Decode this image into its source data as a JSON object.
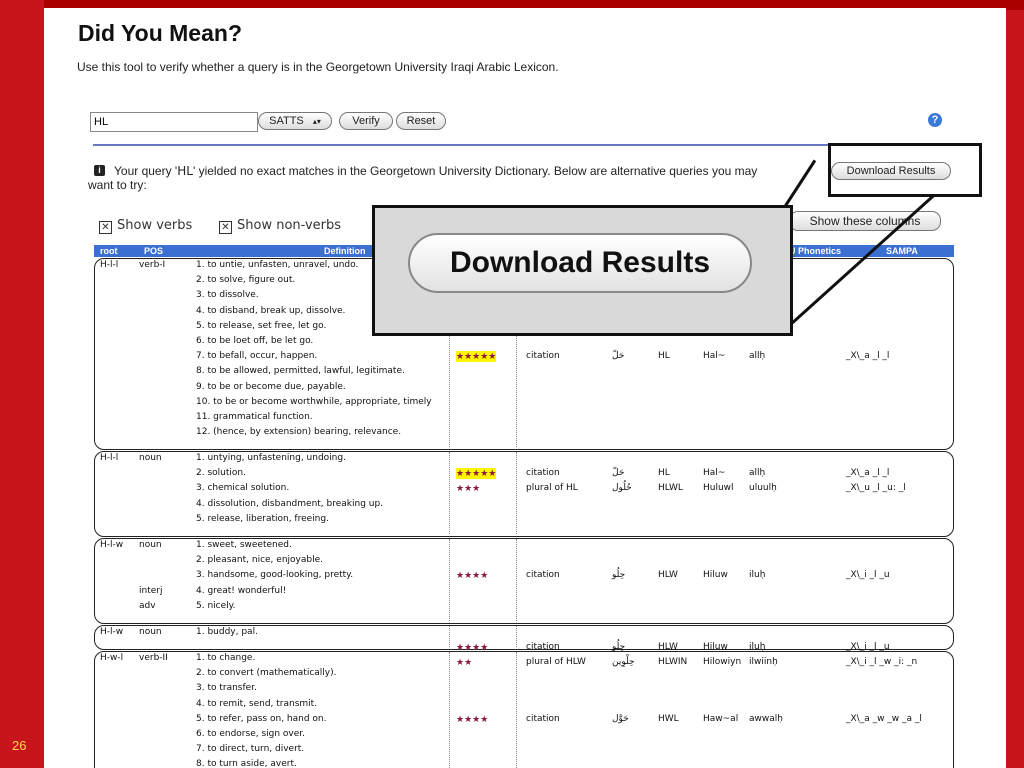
{
  "slide_number": "26",
  "page": {
    "title": "Did You Mean?",
    "subtitle": "Use this tool to verify whether a query is in the Georgetown University Iraqi Arabic Lexicon."
  },
  "search": {
    "query_value": "HL",
    "scheme_select": "SATTS",
    "verify_label": "Verify",
    "reset_label": "Reset",
    "help_icon": "?"
  },
  "message": {
    "text_before": "Your query '",
    "query": "HL",
    "text_after": "' yielded no exact matches in the Georgetown University Dictionary. Below are alternative queries you may",
    "text_line2": "want to try:",
    "download_label": "Download Results"
  },
  "filters": {
    "show_verbs": "Show verbs",
    "show_nonverbs": "Show non-verbs",
    "show_columns": "Show these columns"
  },
  "columns": [
    "root",
    "POS",
    "Definition",
    "U Phonetics",
    "SAMPA"
  ],
  "callout": {
    "label": "Download Results"
  },
  "rows": [
    {
      "root": "H-l-l",
      "pos": "verb-I",
      "defs": [
        "1. to untie, unfasten, unravel, undo.",
        "2. to solve, figure out.",
        "3. to dissolve.",
        "4. to disband, break up, dissolve.",
        "5. to release, set free, let go.",
        "6. to be loet off, be let go.",
        "7. to befall, occur, happen.",
        "8. to be allowed, permitted, lawful, legitimate.",
        "9. to be or become due, payable.",
        "10. to be or become worthwhile, appropriate, timely",
        "11. grammatical function.",
        "12. (hence, by extension) bearing, relevance."
      ],
      "entries": [
        {
          "stars": "★★★★★",
          "highlight": true,
          "type": "citation",
          "arabic": "حَلّ",
          "satts": "HL",
          "buck": "Hal~",
          "phon": "allḥ",
          "sampa": "_X\\_a _l _l"
        }
      ]
    },
    {
      "root": "H-l-l",
      "pos": "noun",
      "defs": [
        "1. untying, unfastening, undoing.",
        "2. solution.",
        "3. chemical solution.",
        "4. dissolution, disbandment, breaking up.",
        "5. release, liberation, freeing."
      ],
      "entries": [
        {
          "stars": "★★★★★",
          "highlight": true,
          "type": "citation",
          "arabic": "حَلّ",
          "satts": "HL",
          "buck": "Hal~",
          "phon": "allḥ",
          "sampa": "_X\\_a _l _l"
        },
        {
          "stars": "★★★",
          "highlight": false,
          "type": "plural of HL",
          "arabic": "حُلُول",
          "satts": "HLWL",
          "buck": "Huluwl",
          "phon": "uluulḥ",
          "sampa": "_X\\_u _l _u: _l"
        }
      ]
    },
    {
      "root": "H-l-w",
      "pos": "noun",
      "pos_extra": [
        "interj",
        "adv"
      ],
      "defs": [
        "1. sweet, sweetened.",
        "2. pleasant, nice, enjoyable.",
        "3. handsome, good-looking, pretty.",
        "4. great! wonderful!",
        "5. nicely."
      ],
      "entries": [
        {
          "stars": "★★★★",
          "highlight": false,
          "type": "citation",
          "arabic": "حِلُو",
          "satts": "HLW",
          "buck": "Hiluw",
          "phon": "iluḥ",
          "sampa": "_X\\_i _l _u"
        }
      ]
    },
    {
      "root": "H-l-w",
      "pos": "noun",
      "defs": [
        "1. buddy, pal."
      ],
      "entries": [
        {
          "stars": "★★★★",
          "highlight": false,
          "type": "citation",
          "arabic": "حِلُو",
          "satts": "HLW",
          "buck": "Hiluw",
          "phon": "iluḥ",
          "sampa": "_X\\_i _l _u"
        },
        {
          "stars": "★★",
          "highlight": false,
          "type": "plural of HLW",
          "arabic": "حِلْوِين",
          "satts": "HLWIN",
          "buck": "Hilowiyn",
          "phon": "ilwiinḥ",
          "sampa": "_X\\_i _l _w _i: _n"
        }
      ]
    },
    {
      "root": "H-w-l",
      "pos": "verb-II",
      "defs": [
        "1. to change.",
        "2. to convert (mathematically).",
        "3. to transfer.",
        "4. to remit, send, transmit.",
        "5. to refer, pass on, hand on.",
        "6. to endorse, sign over.",
        "7. to direct, turn, divert.",
        "8. to turn aside, avert."
      ],
      "entries": [
        {
          "stars": "★★★★",
          "highlight": false,
          "type": "citation",
          "arabic": "حَوَّل",
          "satts": "HWL",
          "buck": "Haw~al",
          "phon": "awwalḥ",
          "sampa": "_X\\_a _w _w _a _l"
        }
      ]
    }
  ]
}
